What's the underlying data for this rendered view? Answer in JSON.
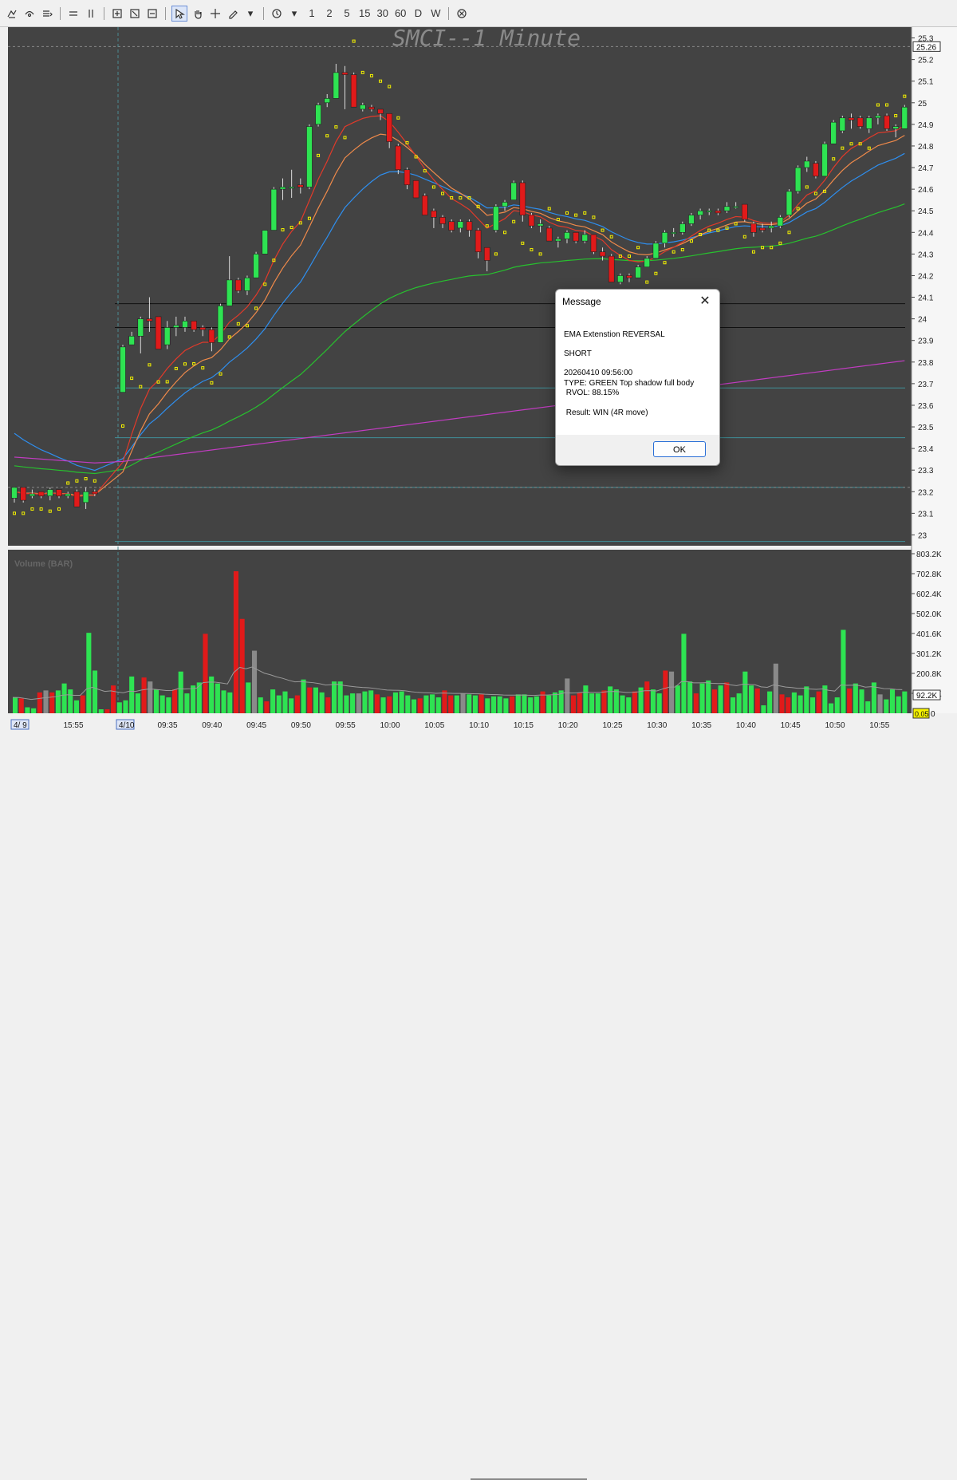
{
  "toolbar": {
    "groups": [
      [
        "draw-tool-a",
        "draw-tool-b",
        "lines-menu",
        "sep",
        "grid-a",
        "grid-b",
        "sep",
        "zoom-box",
        "zoom-fit",
        "zoom-out",
        "sep",
        "pointer",
        "hand",
        "crosshair",
        "pen-menu",
        "sep",
        "clock-menu"
      ],
      []
    ],
    "intervals": [
      "1",
      "2",
      "5",
      "15",
      "30",
      "60",
      "D",
      "W"
    ],
    "icons": [
      "pen-icon",
      "cursor-pointer-icon",
      "hand-icon",
      "crosshair-icon",
      "clock-icon",
      "cancel-icon"
    ]
  },
  "chart": {
    "title": "SMCI--1 Minute",
    "price_ticks": [
      "25.3",
      "25.2",
      "25.1",
      "25",
      "24.9",
      "24.8",
      "24.7",
      "24.6",
      "24.5",
      "24.4",
      "24.3",
      "24.2",
      "24.1",
      "24",
      "23.9",
      "23.8",
      "23.7",
      "23.6",
      "23.5",
      "23.4",
      "23.3",
      "23.2",
      "23.1",
      "23"
    ],
    "current_price_label": "25.26",
    "volume_label": "Volume (BAR)",
    "volume_ticks": [
      "803.2K",
      "702.8K",
      "602.4K",
      "502.0K",
      "401.6K",
      "301.2K",
      "200.8K",
      "100.4K"
    ],
    "volume_current_label": "92.2K",
    "volume_zero_label": "0.05",
    "volume_zero_tick": "0",
    "time_labels": [
      "15:55",
      "09:35",
      "09:40",
      "09:45",
      "09:50",
      "09:55",
      "10:00",
      "10:05",
      "10:10",
      "10:15",
      "10:20",
      "10:25",
      "10:30",
      "10:35",
      "10:40",
      "10:45",
      "10:50",
      "10:55"
    ],
    "date_labels": [
      "4/ 9",
      "4/10"
    ],
    "colors": {
      "background": "#434343",
      "up": "#2ee352",
      "down": "#e11a1a",
      "ema_fast": "#e23a2a",
      "ema_mid": "#f08a4a",
      "ema_slow": "#2e8ff0",
      "ema_long": "#27c12e",
      "sma_200": "#c23cc2",
      "psar": "#f5f200"
    }
  },
  "chart_data": {
    "type": "candlestick",
    "title": "SMCI--1 Minute",
    "ylim": [
      22.95,
      25.35
    ],
    "candles": [
      {
        "t": "15:51",
        "o": 23.17,
        "h": 23.22,
        "l": 23.15,
        "c": 23.22
      },
      {
        "t": "15:52",
        "o": 23.22,
        "h": 23.22,
        "l": 23.15,
        "c": 23.16
      },
      {
        "t": "15:53",
        "o": 23.18,
        "h": 23.21,
        "l": 23.17,
        "c": 23.19
      },
      {
        "t": "15:54",
        "o": 23.2,
        "h": 23.2,
        "l": 23.17,
        "c": 23.18
      },
      {
        "t": "15:55",
        "o": 23.18,
        "h": 23.22,
        "l": 23.16,
        "c": 23.21
      },
      {
        "t": "15:56",
        "o": 23.21,
        "h": 23.21,
        "l": 23.17,
        "c": 23.18
      },
      {
        "t": "15:57",
        "o": 23.18,
        "h": 23.2,
        "l": 23.17,
        "c": 23.19
      },
      {
        "t": "15:58",
        "o": 23.2,
        "h": 23.21,
        "l": 23.13,
        "c": 23.13
      },
      {
        "t": "15:59",
        "o": 23.15,
        "h": 23.22,
        "l": 23.12,
        "c": 23.2
      },
      {
        "t": "16:00",
        "o": 23.2,
        "h": 23.21,
        "l": 23.18,
        "c": 23.19
      },
      {
        "t": "09:31",
        "o": 23.66,
        "h": 23.88,
        "l": 23.66,
        "c": 23.87
      },
      {
        "t": "09:32",
        "o": 23.88,
        "h": 23.94,
        "l": 23.88,
        "c": 23.92
      },
      {
        "t": "09:33",
        "o": 23.92,
        "h": 24.01,
        "l": 23.84,
        "c": 24.0
      },
      {
        "t": "09:34",
        "o": 24.0,
        "h": 24.1,
        "l": 23.94,
        "c": 23.99
      },
      {
        "t": "09:35",
        "o": 24.01,
        "h": 24.01,
        "l": 23.86,
        "c": 23.86
      },
      {
        "t": "09:36",
        "o": 23.88,
        "h": 23.99,
        "l": 23.86,
        "c": 23.96
      },
      {
        "t": "09:37",
        "o": 23.96,
        "h": 24.01,
        "l": 23.92,
        "c": 23.97
      },
      {
        "t": "09:38",
        "o": 23.96,
        "h": 24.01,
        "l": 23.94,
        "c": 23.99
      },
      {
        "t": "09:39",
        "o": 23.99,
        "h": 23.99,
        "l": 23.94,
        "c": 23.95
      },
      {
        "t": "09:40",
        "o": 23.96,
        "h": 23.97,
        "l": 23.92,
        "c": 23.95
      },
      {
        "t": "09:41",
        "o": 23.95,
        "h": 23.96,
        "l": 23.85,
        "c": 23.89
      },
      {
        "t": "09:42",
        "o": 23.89,
        "h": 24.07,
        "l": 23.89,
        "c": 24.06
      },
      {
        "t": "09:43",
        "o": 24.06,
        "h": 24.29,
        "l": 24.06,
        "c": 24.18
      },
      {
        "t": "09:44",
        "o": 24.18,
        "h": 24.19,
        "l": 24.12,
        "c": 24.13
      },
      {
        "t": "09:45",
        "o": 24.13,
        "h": 24.2,
        "l": 24.11,
        "c": 24.19
      },
      {
        "t": "09:46",
        "o": 24.19,
        "h": 24.31,
        "l": 24.19,
        "c": 24.3
      },
      {
        "t": "09:47",
        "o": 24.3,
        "h": 24.41,
        "l": 24.3,
        "c": 24.41
      },
      {
        "t": "09:48",
        "o": 24.41,
        "h": 24.61,
        "l": 24.41,
        "c": 24.6
      },
      {
        "t": "09:49",
        "o": 24.6,
        "h": 24.65,
        "l": 24.55,
        "c": 24.61
      },
      {
        "t": "09:50",
        "o": 24.61,
        "h": 24.69,
        "l": 24.56,
        "c": 24.61
      },
      {
        "t": "09:51",
        "o": 24.62,
        "h": 24.65,
        "l": 24.58,
        "c": 24.61
      },
      {
        "t": "09:52",
        "o": 24.61,
        "h": 24.9,
        "l": 24.6,
        "c": 24.89
      },
      {
        "t": "09:53",
        "o": 24.9,
        "h": 25.0,
        "l": 24.89,
        "c": 24.99
      },
      {
        "t": "09:54",
        "o": 25.0,
        "h": 25.04,
        "l": 24.98,
        "c": 25.02
      },
      {
        "t": "09:55",
        "o": 25.02,
        "h": 25.18,
        "l": 25.02,
        "c": 25.14
      },
      {
        "t": "09:56",
        "o": 25.14,
        "h": 25.17,
        "l": 24.97,
        "c": 25.13
      },
      {
        "t": "09:57",
        "o": 25.13,
        "h": 25.14,
        "l": 24.98,
        "c": 24.98
      },
      {
        "t": "09:58",
        "o": 24.97,
        "h": 25.0,
        "l": 24.96,
        "c": 24.99
      },
      {
        "t": "09:59",
        "o": 24.98,
        "h": 24.99,
        "l": 24.96,
        "c": 24.97
      },
      {
        "t": "10:00",
        "o": 24.97,
        "h": 24.97,
        "l": 24.92,
        "c": 24.95
      },
      {
        "t": "10:01",
        "o": 24.95,
        "h": 24.95,
        "l": 24.79,
        "c": 24.82
      },
      {
        "t": "10:02",
        "o": 24.8,
        "h": 24.81,
        "l": 24.67,
        "c": 24.69
      },
      {
        "t": "10:03",
        "o": 24.69,
        "h": 24.7,
        "l": 24.6,
        "c": 24.62
      },
      {
        "t": "10:04",
        "o": 24.64,
        "h": 24.64,
        "l": 24.56,
        "c": 24.56
      },
      {
        "t": "10:05",
        "o": 24.57,
        "h": 24.58,
        "l": 24.48,
        "c": 24.48
      },
      {
        "t": "10:06",
        "o": 24.5,
        "h": 24.51,
        "l": 24.42,
        "c": 24.47
      },
      {
        "t": "10:07",
        "o": 24.47,
        "h": 24.48,
        "l": 24.42,
        "c": 24.44
      },
      {
        "t": "10:08",
        "o": 24.45,
        "h": 24.46,
        "l": 24.4,
        "c": 24.41
      },
      {
        "t": "10:09",
        "o": 24.42,
        "h": 24.46,
        "l": 24.4,
        "c": 24.45
      },
      {
        "t": "10:10",
        "o": 24.45,
        "h": 24.46,
        "l": 24.38,
        "c": 24.41
      },
      {
        "t": "10:11",
        "o": 24.41,
        "h": 24.42,
        "l": 24.28,
        "c": 24.31
      },
      {
        "t": "10:12",
        "o": 24.33,
        "h": 24.33,
        "l": 24.22,
        "c": 24.27
      },
      {
        "t": "10:13",
        "o": 24.41,
        "h": 24.53,
        "l": 24.4,
        "c": 24.52
      },
      {
        "t": "10:14",
        "o": 24.52,
        "h": 24.55,
        "l": 24.5,
        "c": 24.54
      },
      {
        "t": "10:15",
        "o": 24.55,
        "h": 24.64,
        "l": 24.55,
        "c": 24.63
      },
      {
        "t": "10:16",
        "o": 24.63,
        "h": 24.64,
        "l": 24.45,
        "c": 24.48
      },
      {
        "t": "10:17",
        "o": 24.48,
        "h": 24.49,
        "l": 24.42,
        "c": 24.43
      },
      {
        "t": "10:18",
        "o": 24.43,
        "h": 24.46,
        "l": 24.4,
        "c": 24.44
      },
      {
        "t": "10:19",
        "o": 24.42,
        "h": 24.43,
        "l": 24.36,
        "c": 24.36
      },
      {
        "t": "10:20",
        "o": 24.36,
        "h": 24.38,
        "l": 24.33,
        "c": 24.37
      },
      {
        "t": "10:21",
        "o": 24.37,
        "h": 24.41,
        "l": 24.35,
        "c": 24.4
      },
      {
        "t": "10:22",
        "o": 24.4,
        "h": 24.4,
        "l": 24.35,
        "c": 24.36
      },
      {
        "t": "10:23",
        "o": 24.36,
        "h": 24.41,
        "l": 24.35,
        "c": 24.39
      },
      {
        "t": "10:24",
        "o": 24.39,
        "h": 24.39,
        "l": 24.3,
        "c": 24.31
      },
      {
        "t": "10:25",
        "o": 24.31,
        "h": 24.33,
        "l": 24.27,
        "c": 24.29
      },
      {
        "t": "10:26",
        "o": 24.29,
        "h": 24.3,
        "l": 24.17,
        "c": 24.17
      },
      {
        "t": "10:27",
        "o": 24.17,
        "h": 24.21,
        "l": 24.16,
        "c": 24.2
      },
      {
        "t": "10:28",
        "o": 24.2,
        "h": 24.21,
        "l": 24.17,
        "c": 24.19
      },
      {
        "t": "10:29",
        "o": 24.19,
        "h": 24.25,
        "l": 24.19,
        "c": 24.24
      },
      {
        "t": "10:30",
        "o": 24.24,
        "h": 24.29,
        "l": 24.24,
        "c": 24.28
      },
      {
        "t": "10:31",
        "o": 24.28,
        "h": 24.36,
        "l": 24.28,
        "c": 24.35
      },
      {
        "t": "10:32",
        "o": 24.35,
        "h": 24.41,
        "l": 24.33,
        "c": 24.4
      },
      {
        "t": "10:33",
        "o": 24.4,
        "h": 24.42,
        "l": 24.38,
        "c": 24.4
      },
      {
        "t": "10:34",
        "o": 24.4,
        "h": 24.45,
        "l": 24.39,
        "c": 24.44
      },
      {
        "t": "10:35",
        "o": 24.44,
        "h": 24.49,
        "l": 24.43,
        "c": 24.48
      },
      {
        "t": "10:36",
        "o": 24.48,
        "h": 24.51,
        "l": 24.46,
        "c": 24.5
      },
      {
        "t": "10:37",
        "o": 24.5,
        "h": 24.51,
        "l": 24.48,
        "c": 24.5
      },
      {
        "t": "10:38",
        "o": 24.5,
        "h": 24.51,
        "l": 24.48,
        "c": 24.49
      },
      {
        "t": "10:39",
        "o": 24.5,
        "h": 24.54,
        "l": 24.49,
        "c": 24.52
      },
      {
        "t": "10:40",
        "o": 24.52,
        "h": 24.54,
        "l": 24.51,
        "c": 24.52
      },
      {
        "t": "10:41",
        "o": 24.53,
        "h": 24.53,
        "l": 24.45,
        "c": 24.46
      },
      {
        "t": "10:42",
        "o": 24.44,
        "h": 24.45,
        "l": 24.38,
        "c": 24.4
      },
      {
        "t": "10:43",
        "o": 24.42,
        "h": 24.44,
        "l": 24.4,
        "c": 24.41
      },
      {
        "t": "10:44",
        "o": 24.42,
        "h": 24.45,
        "l": 24.4,
        "c": 24.43
      },
      {
        "t": "10:45",
        "o": 24.43,
        "h": 24.48,
        "l": 24.42,
        "c": 24.47
      },
      {
        "t": "10:46",
        "o": 24.48,
        "h": 24.6,
        "l": 24.47,
        "c": 24.59
      },
      {
        "t": "10:47",
        "o": 24.59,
        "h": 24.71,
        "l": 24.58,
        "c": 24.7
      },
      {
        "t": "10:48",
        "o": 24.7,
        "h": 24.75,
        "l": 24.68,
        "c": 24.73
      },
      {
        "t": "10:49",
        "o": 24.72,
        "h": 24.73,
        "l": 24.65,
        "c": 24.66
      },
      {
        "t": "10:50",
        "o": 24.66,
        "h": 24.82,
        "l": 24.66,
        "c": 24.81
      },
      {
        "t": "10:51",
        "o": 24.81,
        "h": 24.92,
        "l": 24.81,
        "c": 24.91
      },
      {
        "t": "10:52",
        "o": 24.87,
        "h": 24.94,
        "l": 24.86,
        "c": 24.93
      },
      {
        "t": "10:53",
        "o": 24.93,
        "h": 24.95,
        "l": 24.88,
        "c": 24.92
      },
      {
        "t": "10:54",
        "o": 24.93,
        "h": 24.94,
        "l": 24.88,
        "c": 24.89
      },
      {
        "t": "10:55",
        "o": 24.88,
        "h": 24.94,
        "l": 24.86,
        "c": 24.93
      },
      {
        "t": "10:56",
        "o": 24.93,
        "h": 24.95,
        "l": 24.9,
        "c": 24.94
      },
      {
        "t": "10:57",
        "o": 24.94,
        "h": 24.95,
        "l": 24.87,
        "c": 24.88
      },
      {
        "t": "10:58",
        "o": 24.88,
        "h": 24.9,
        "l": 24.84,
        "c": 24.89
      },
      {
        "t": "10:59",
        "o": 24.88,
        "h": 24.99,
        "l": 24.88,
        "c": 24.98
      }
    ],
    "volume": [
      80,
      75,
      30,
      25,
      105,
      115,
      105,
      115,
      150,
      120,
      65,
      90,
      405,
      215,
      20,
      20,
      140,
      55,
      65,
      185,
      100,
      180,
      160,
      120,
      90,
      80,
      120,
      210,
      100,
      140,
      155,
      400,
      185,
      150,
      115,
      105,
      715,
      475,
      155,
      315,
      80,
      60,
      120,
      90,
      110,
      75,
      90,
      170,
      130,
      130,
      105,
      80,
      160,
      160,
      90,
      100,
      100,
      110,
      115,
      95,
      80,
      85,
      105,
      110,
      90,
      70,
      75,
      90,
      95,
      80,
      115,
      90,
      90,
      100,
      95,
      90,
      95,
      75,
      85,
      85,
      75,
      85,
      95,
      95,
      80,
      85,
      110,
      90,
      105,
      115,
      175,
      90,
      105,
      140,
      100,
      100,
      115,
      135,
      120,
      90,
      80,
      110,
      130,
      160,
      120,
      100,
      215,
      210,
      140,
      400,
      160,
      100,
      150,
      165,
      120,
      140,
      155,
      80,
      100,
      210,
      140,
      125,
      40,
      110,
      250,
      95,
      80,
      105,
      90,
      135,
      80,
      110,
      140,
      50,
      80,
      420,
      125,
      150,
      120,
      60,
      155,
      95,
      70,
      120,
      85,
      110
    ],
    "horizontal_levels": [
      24.07,
      23.96,
      23.68,
      23.45,
      23.22,
      22.97
    ],
    "current_price": 25.26,
    "volume_ylim": [
      0,
      803.2
    ],
    "volume_unit": "K"
  },
  "dialog": {
    "title": "Message",
    "close_glyph": "✕",
    "lines": [
      "EMA Extenstion REVERSAL",
      "",
      "SHORT",
      "",
      "20260410 09:56:00",
      "TYPE: GREEN Top shadow full body",
      " RVOL: 88.15%",
      "",
      " Result: WIN (4R move)"
    ],
    "ok_label": "OK"
  }
}
